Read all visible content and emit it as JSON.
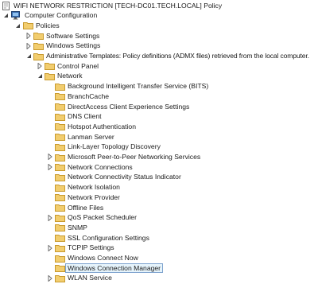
{
  "tree": {
    "root": {
      "label": "WIFI NETWORK RESTRICTION [TECH-DC01.TECH.LOCAL] Policy",
      "icon": "policy-doc-icon"
    },
    "computer_configuration": {
      "label": "Computer Configuration",
      "icon": "computer-icon",
      "state": "expanded"
    },
    "policies": {
      "label": "Policies",
      "icon": "folder-icon",
      "state": "expanded"
    },
    "software_settings": {
      "label": "Software Settings",
      "icon": "folder-icon",
      "state": "collapsed"
    },
    "windows_settings": {
      "label": "Windows Settings",
      "icon": "folder-icon",
      "state": "collapsed"
    },
    "administrative_templates": {
      "label": "Administrative Templates: Policy definitions (ADMX files) retrieved from the local computer.",
      "icon": "folder-icon",
      "state": "expanded"
    },
    "control_panel": {
      "label": "Control Panel",
      "icon": "folder-icon",
      "state": "collapsed"
    },
    "network": {
      "label": "Network",
      "icon": "folder-icon",
      "state": "expanded"
    },
    "network_children": [
      {
        "label": "Background Intelligent Transfer Service (BITS)",
        "state": "leaf"
      },
      {
        "label": "BranchCache",
        "state": "leaf"
      },
      {
        "label": "DirectAccess Client Experience Settings",
        "state": "leaf"
      },
      {
        "label": "DNS Client",
        "state": "leaf"
      },
      {
        "label": "Hotspot Authentication",
        "state": "leaf"
      },
      {
        "label": "Lanman Server",
        "state": "leaf"
      },
      {
        "label": "Link-Layer Topology Discovery",
        "state": "leaf"
      },
      {
        "label": "Microsoft Peer-to-Peer Networking Services",
        "state": "collapsed"
      },
      {
        "label": "Network Connections",
        "state": "collapsed"
      },
      {
        "label": "Network Connectivity Status Indicator",
        "state": "leaf"
      },
      {
        "label": "Network Isolation",
        "state": "leaf"
      },
      {
        "label": "Network Provider",
        "state": "leaf"
      },
      {
        "label": "Offline Files",
        "state": "leaf"
      },
      {
        "label": "QoS Packet Scheduler",
        "state": "collapsed"
      },
      {
        "label": "SNMP",
        "state": "leaf"
      },
      {
        "label": "SSL Configuration Settings",
        "state": "leaf"
      },
      {
        "label": "TCPIP Settings",
        "state": "collapsed"
      },
      {
        "label": "Windows Connect Now",
        "state": "leaf"
      },
      {
        "label": "Windows Connection Manager",
        "state": "leaf",
        "selected": true
      },
      {
        "label": "WLAN Service",
        "state": "collapsed"
      }
    ]
  },
  "colors": {
    "folder_fill": "#f2cd6e",
    "folder_edge": "#c89a2e",
    "selection_bg": "#e5f3fb",
    "selection_border": "#7da2ce",
    "text": "#1a1a1a",
    "arrow_collapsed": "#6f6f6f",
    "arrow_expanded": "#404040"
  }
}
